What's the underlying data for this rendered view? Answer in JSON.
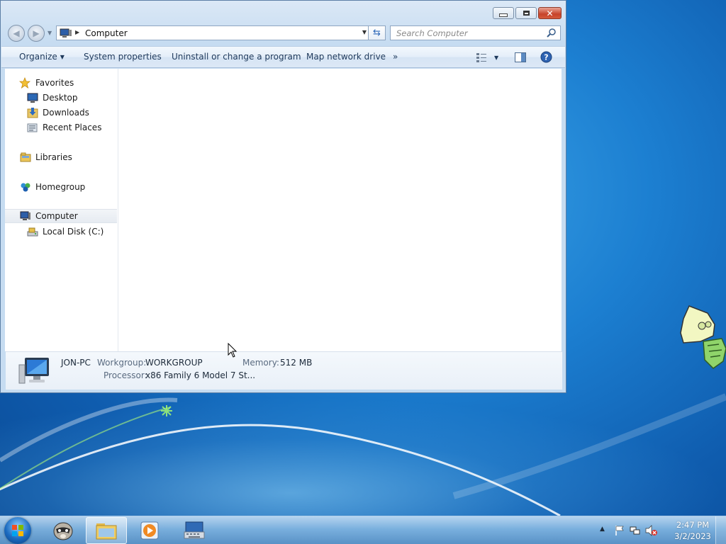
{
  "window": {
    "address_text": "Computer",
    "search_placeholder": "Search Computer"
  },
  "toolbar": {
    "organize": "Organize",
    "system_properties": "System properties",
    "uninstall": "Uninstall or change a program",
    "map_network": "Map network drive",
    "more": "»"
  },
  "navpane": {
    "favorites": "Favorites",
    "desktop": "Desktop",
    "downloads": "Downloads",
    "recent_places": "Recent Places",
    "libraries": "Libraries",
    "homegroup": "Homegroup",
    "computer": "Computer",
    "local_disk": "Local Disk (C:)"
  },
  "details": {
    "pc_name": "JON-PC",
    "workgroup_label": "Workgroup:",
    "workgroup_value": "WORKGROUP",
    "memory_label": "Memory:",
    "memory_value": "512 MB",
    "processor_label": "Processor:",
    "processor_value": "x86 Family 6 Model 7 St..."
  },
  "taskbar": {
    "time": "2:47 PM",
    "date": "3/2/2023"
  }
}
